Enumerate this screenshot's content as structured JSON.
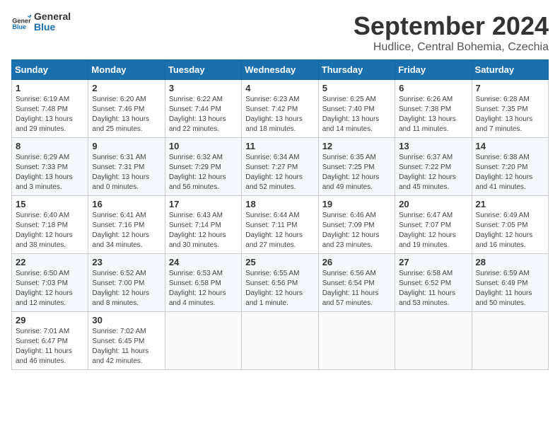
{
  "header": {
    "logo": {
      "general": "General",
      "blue": "Blue"
    },
    "title": "September 2024",
    "location": "Hudlice, Central Bohemia, Czechia"
  },
  "weekdays": [
    "Sunday",
    "Monday",
    "Tuesday",
    "Wednesday",
    "Thursday",
    "Friday",
    "Saturday"
  ],
  "weeks": [
    [
      {
        "day": "1",
        "sunrise": "6:19 AM",
        "sunset": "7:48 PM",
        "daylight": "13 hours and 29 minutes."
      },
      {
        "day": "2",
        "sunrise": "6:20 AM",
        "sunset": "7:46 PM",
        "daylight": "13 hours and 25 minutes."
      },
      {
        "day": "3",
        "sunrise": "6:22 AM",
        "sunset": "7:44 PM",
        "daylight": "13 hours and 22 minutes."
      },
      {
        "day": "4",
        "sunrise": "6:23 AM",
        "sunset": "7:42 PM",
        "daylight": "13 hours and 18 minutes."
      },
      {
        "day": "5",
        "sunrise": "6:25 AM",
        "sunset": "7:40 PM",
        "daylight": "13 hours and 14 minutes."
      },
      {
        "day": "6",
        "sunrise": "6:26 AM",
        "sunset": "7:38 PM",
        "daylight": "13 hours and 11 minutes."
      },
      {
        "day": "7",
        "sunrise": "6:28 AM",
        "sunset": "7:35 PM",
        "daylight": "13 hours and 7 minutes."
      }
    ],
    [
      {
        "day": "8",
        "sunrise": "6:29 AM",
        "sunset": "7:33 PM",
        "daylight": "13 hours and 3 minutes."
      },
      {
        "day": "9",
        "sunrise": "6:31 AM",
        "sunset": "7:31 PM",
        "daylight": "13 hours and 0 minutes."
      },
      {
        "day": "10",
        "sunrise": "6:32 AM",
        "sunset": "7:29 PM",
        "daylight": "12 hours and 56 minutes."
      },
      {
        "day": "11",
        "sunrise": "6:34 AM",
        "sunset": "7:27 PM",
        "daylight": "12 hours and 52 minutes."
      },
      {
        "day": "12",
        "sunrise": "6:35 AM",
        "sunset": "7:25 PM",
        "daylight": "12 hours and 49 minutes."
      },
      {
        "day": "13",
        "sunrise": "6:37 AM",
        "sunset": "7:22 PM",
        "daylight": "12 hours and 45 minutes."
      },
      {
        "day": "14",
        "sunrise": "6:38 AM",
        "sunset": "7:20 PM",
        "daylight": "12 hours and 41 minutes."
      }
    ],
    [
      {
        "day": "15",
        "sunrise": "6:40 AM",
        "sunset": "7:18 PM",
        "daylight": "12 hours and 38 minutes."
      },
      {
        "day": "16",
        "sunrise": "6:41 AM",
        "sunset": "7:16 PM",
        "daylight": "12 hours and 34 minutes."
      },
      {
        "day": "17",
        "sunrise": "6:43 AM",
        "sunset": "7:14 PM",
        "daylight": "12 hours and 30 minutes."
      },
      {
        "day": "18",
        "sunrise": "6:44 AM",
        "sunset": "7:11 PM",
        "daylight": "12 hours and 27 minutes."
      },
      {
        "day": "19",
        "sunrise": "6:46 AM",
        "sunset": "7:09 PM",
        "daylight": "12 hours and 23 minutes."
      },
      {
        "day": "20",
        "sunrise": "6:47 AM",
        "sunset": "7:07 PM",
        "daylight": "12 hours and 19 minutes."
      },
      {
        "day": "21",
        "sunrise": "6:49 AM",
        "sunset": "7:05 PM",
        "daylight": "12 hours and 16 minutes."
      }
    ],
    [
      {
        "day": "22",
        "sunrise": "6:50 AM",
        "sunset": "7:03 PM",
        "daylight": "12 hours and 12 minutes."
      },
      {
        "day": "23",
        "sunrise": "6:52 AM",
        "sunset": "7:00 PM",
        "daylight": "12 hours and 8 minutes."
      },
      {
        "day": "24",
        "sunrise": "6:53 AM",
        "sunset": "6:58 PM",
        "daylight": "12 hours and 4 minutes."
      },
      {
        "day": "25",
        "sunrise": "6:55 AM",
        "sunset": "6:56 PM",
        "daylight": "12 hours and 1 minute."
      },
      {
        "day": "26",
        "sunrise": "6:56 AM",
        "sunset": "6:54 PM",
        "daylight": "11 hours and 57 minutes."
      },
      {
        "day": "27",
        "sunrise": "6:58 AM",
        "sunset": "6:52 PM",
        "daylight": "11 hours and 53 minutes."
      },
      {
        "day": "28",
        "sunrise": "6:59 AM",
        "sunset": "6:49 PM",
        "daylight": "11 hours and 50 minutes."
      }
    ],
    [
      {
        "day": "29",
        "sunrise": "7:01 AM",
        "sunset": "6:47 PM",
        "daylight": "11 hours and 46 minutes."
      },
      {
        "day": "30",
        "sunrise": "7:02 AM",
        "sunset": "6:45 PM",
        "daylight": "11 hours and 42 minutes."
      },
      null,
      null,
      null,
      null,
      null
    ]
  ]
}
